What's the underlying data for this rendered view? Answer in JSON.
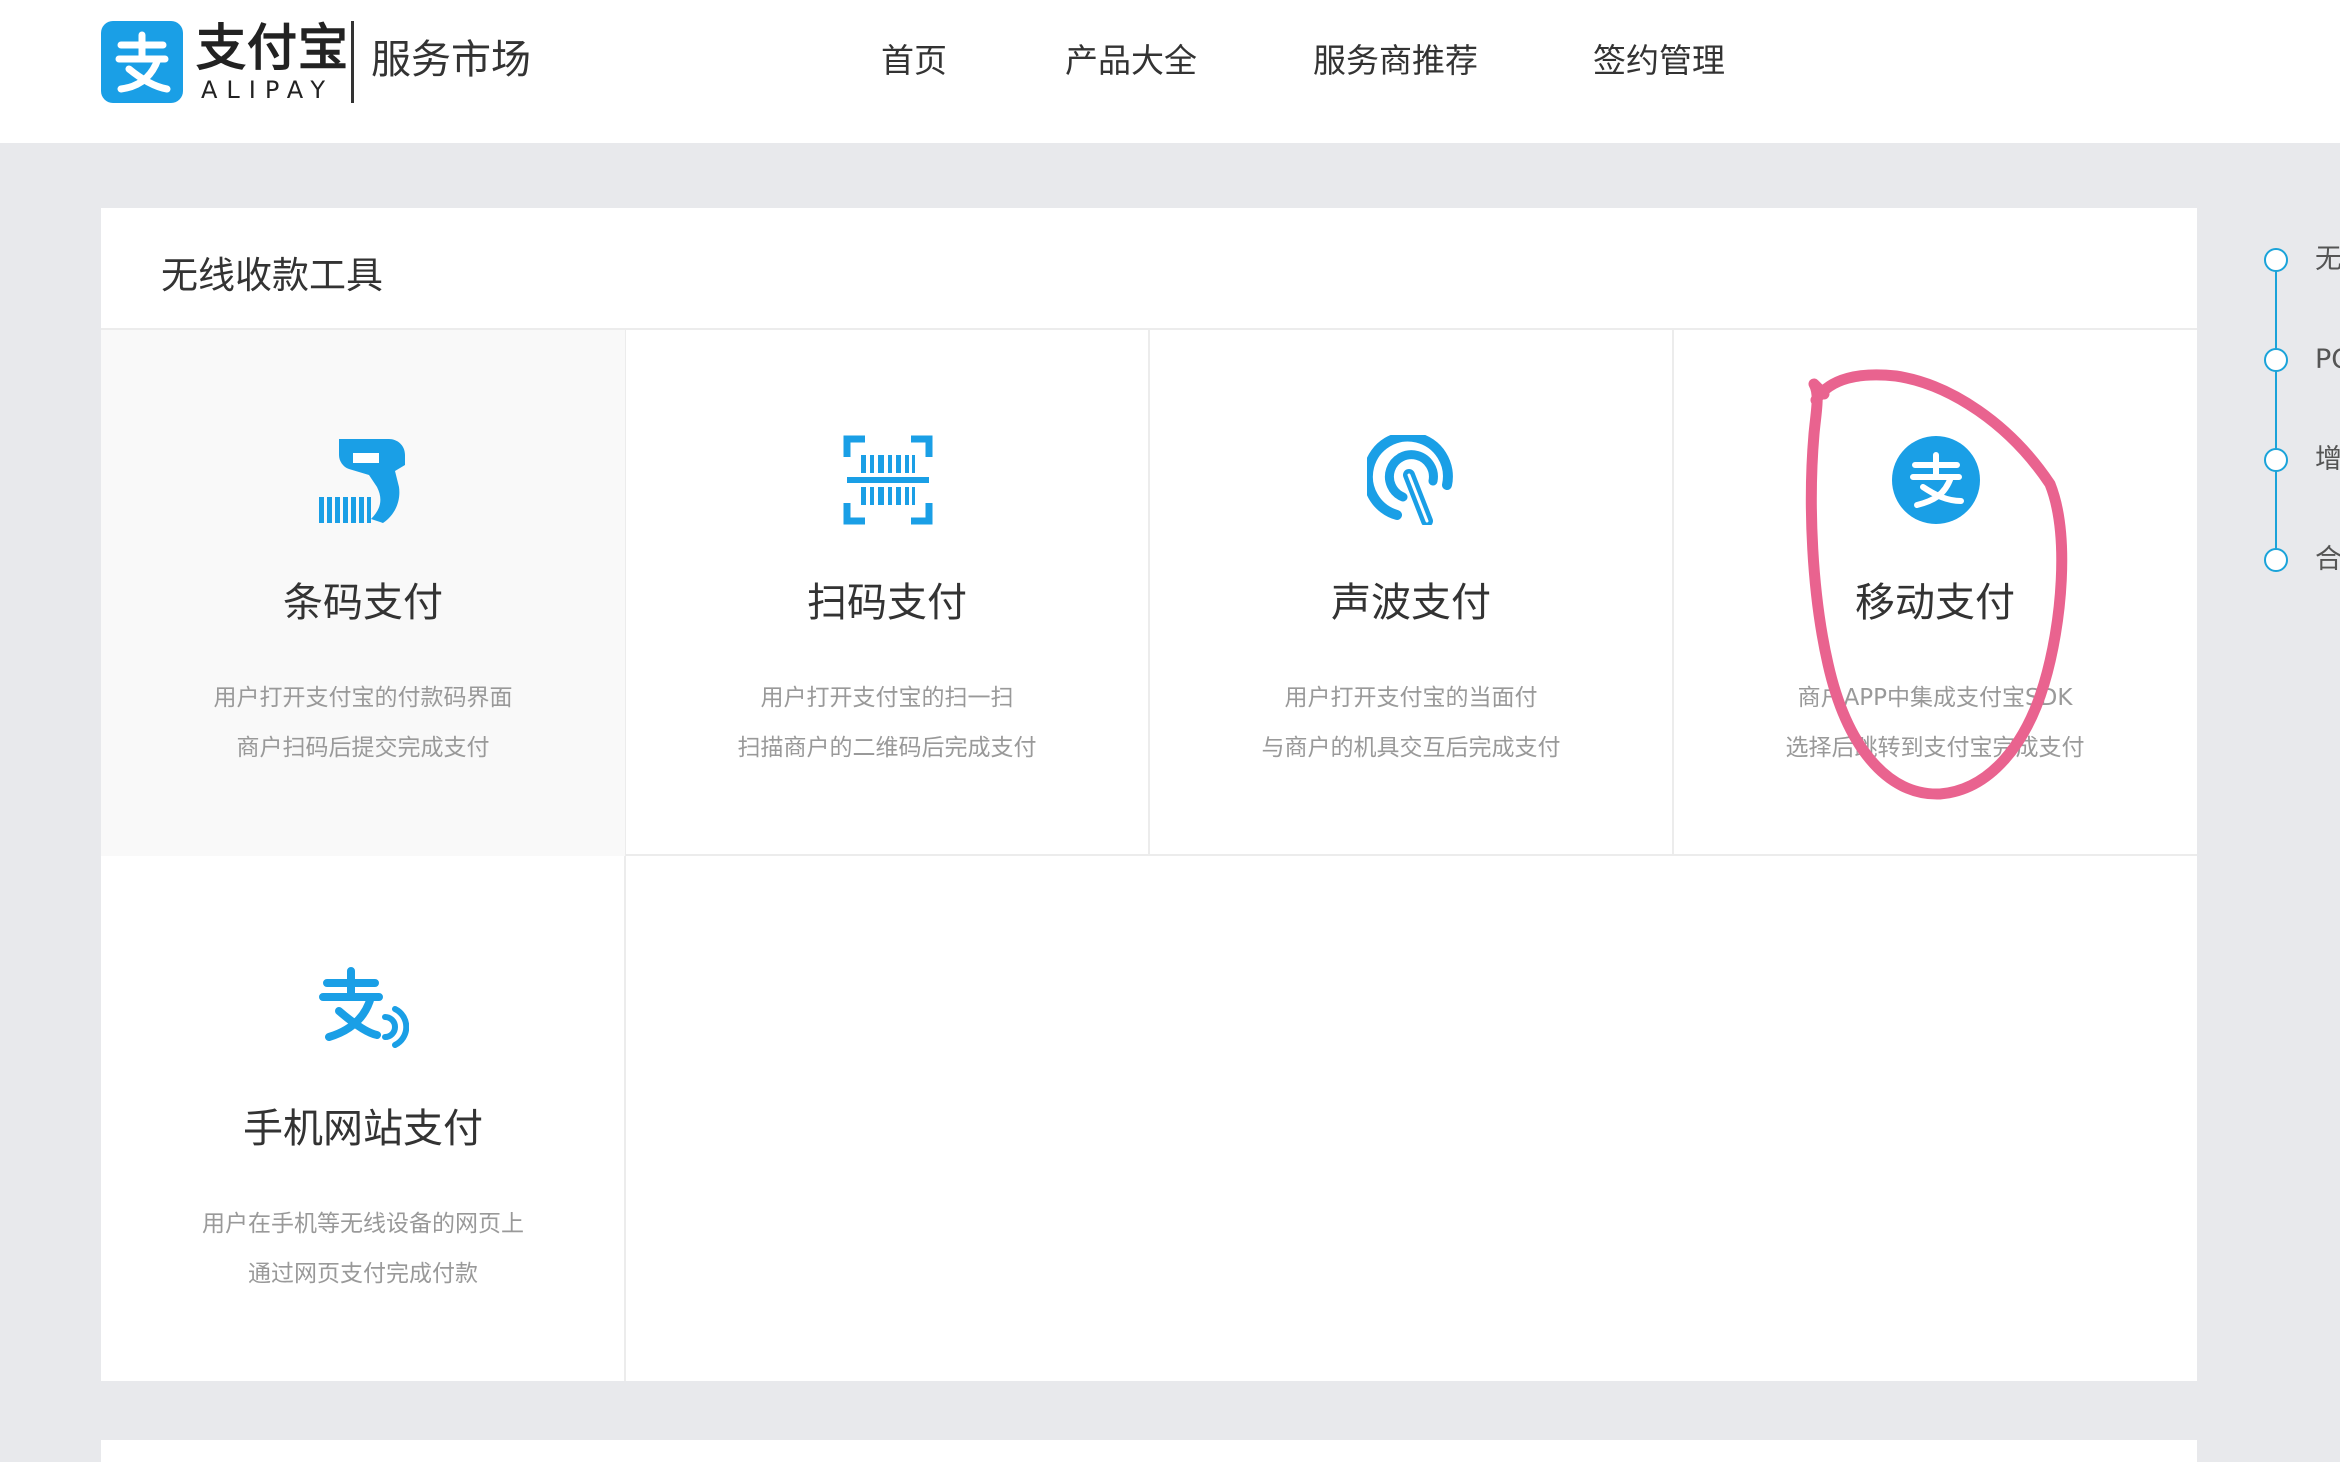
{
  "brand": {
    "name_cn": "支付宝",
    "name_en": "ALIPAY",
    "section": "服务市场",
    "color": "#1a9fe6"
  },
  "nav": {
    "items": [
      {
        "label": "首页"
      },
      {
        "label": "产品大全"
      },
      {
        "label": "服务商推荐"
      },
      {
        "label": "签约管理"
      }
    ]
  },
  "section": {
    "title": "无线收款工具"
  },
  "products": [
    {
      "title": "条码支付",
      "desc1": "用户打开支付宝的付款码界面",
      "desc2": "商户扫码后提交完成支付",
      "icon": "barcode-scanner-icon"
    },
    {
      "title": "扫码支付",
      "desc1": "用户打开支付宝的扫一扫",
      "desc2": "扫描商户的二维码后完成支付",
      "icon": "scan-code-icon"
    },
    {
      "title": "声波支付",
      "desc1": "用户打开支付宝的当面付",
      "desc2": "与商户的机具交互后完成支付",
      "icon": "soundwave-icon"
    },
    {
      "title": "移动支付",
      "desc1": "商户APP中集成支付宝SDK",
      "desc2": "选择后跳转到支付宝完成支付",
      "icon": "alipay-circle-icon"
    },
    {
      "title": "手机网站支付",
      "desc1": "用户在手机等无线设备的网页上",
      "desc2": "通过网页支付完成付款",
      "icon": "alipay-wave-icon"
    }
  ],
  "steps": [
    {
      "label": "无"
    },
    {
      "label": "PC"
    },
    {
      "label": "增"
    },
    {
      "label": "合"
    }
  ],
  "colors": {
    "accent": "#1a9fe6",
    "annotation": "#e9638f"
  }
}
